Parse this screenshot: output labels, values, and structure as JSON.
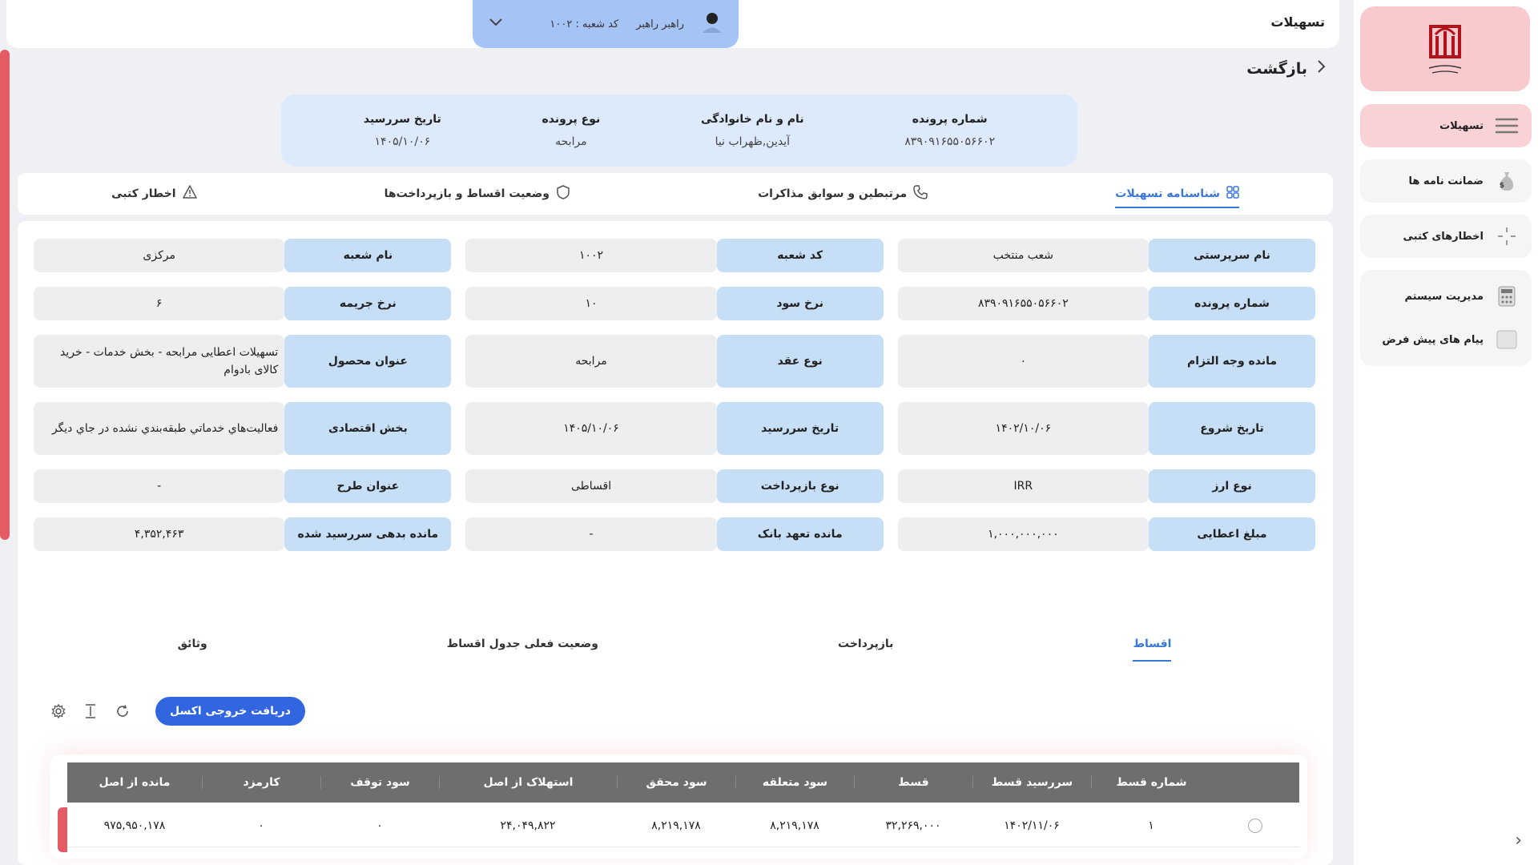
{
  "topbar": {
    "title": "تسهیلات",
    "user_name": "راهبر راهبر",
    "branch_code": "کد شعبه : ۱۰۰۲"
  },
  "sidebar": {
    "items": [
      {
        "label": "تسهیلات",
        "icon": "menu-icon",
        "active": true
      },
      {
        "label": "ضمانت نامه ها",
        "icon": "money-bag-icon"
      },
      {
        "label": "اخطارهای کتبی",
        "icon": "alert-icon"
      },
      {
        "label": "مدیریت سیستم",
        "icon": "calculator-icon"
      },
      {
        "label": "پیام های پیش فرض",
        "icon": "message-icon"
      }
    ]
  },
  "back_label": "بازگشت",
  "summary": [
    {
      "label": "شماره پرونده",
      "value": "۸۳۹۰۹۱۶۵۵۰۵۶۶۰۲"
    },
    {
      "label": "نام و نام خانوادگی",
      "value": "آیدین,ظهراب نیا"
    },
    {
      "label": "نوع پرونده",
      "value": "مرابحه"
    },
    {
      "label": "تاریخ سررسید",
      "value": "۱۴۰۵/۱۰/۰۶"
    }
  ],
  "tabs": [
    {
      "label": "شناسنامه تسهیلات",
      "active": true
    },
    {
      "label": "مرتبطین و سوابق مذاکرات"
    },
    {
      "label": "وضعیت اقساط و بازپرداخت‌ها"
    },
    {
      "label": "اخطار کتبی"
    }
  ],
  "details": {
    "r1": [
      {
        "k": "نام سرپرستی",
        "v": "شعب منتخب"
      },
      {
        "k": "کد شعبه",
        "v": "۱۰۰۲"
      },
      {
        "k": "نام شعبه",
        "v": "مرکزی"
      }
    ],
    "r2": [
      {
        "k": "شماره پرونده",
        "v": "۸۳۹۰۹۱۶۵۵۰۵۶۶۰۲"
      },
      {
        "k": "نرخ سود",
        "v": "۱۰"
      },
      {
        "k": "نرخ جریمه",
        "v": "۶"
      }
    ],
    "r3": [
      {
        "k": "مانده وجه التزام",
        "v": "۰"
      },
      {
        "k": "نوع عقد",
        "v": "مرابحه"
      },
      {
        "k": "عنوان محصول",
        "v": "تسهیلات اعطایی مرابحه - بخش خدمات - خرید کالای بادوام"
      }
    ],
    "r4": [
      {
        "k": "تاریخ شروع",
        "v": "۱۴۰۲/۱۰/۰۶"
      },
      {
        "k": "تاریخ سررسید",
        "v": "۱۴۰۵/۱۰/۰۶"
      },
      {
        "k": "بخش اقتصادی",
        "v": "فعاليت‌هاي خدماتي طبقه‌بندي نشده در جاي ديگر"
      }
    ],
    "r5": [
      {
        "k": "نوع ارز",
        "v": "IRR"
      },
      {
        "k": "نوع بازپرداخت",
        "v": "اقساطی"
      },
      {
        "k": "عنوان طرح",
        "v": "-"
      }
    ],
    "r6": [
      {
        "k": "مبلغ اعطایی",
        "v": "۱,۰۰۰,۰۰۰,۰۰۰"
      },
      {
        "k": "مانده تعهد بانک",
        "v": "-"
      },
      {
        "k": "مانده بدهی سررسید شده",
        "v": "۴,۳۵۲,۴۶۳"
      }
    ]
  },
  "subtabs": [
    {
      "label": "اقساط",
      "active": true
    },
    {
      "label": "بازپرداخت"
    },
    {
      "label": "وضعیت فعلی جدول اقساط"
    },
    {
      "label": "وثائق"
    }
  ],
  "toolbar": {
    "excel_label": "دریافت خروجی اکسل"
  },
  "table": {
    "headers": [
      "",
      "شماره قسط",
      "سررسید قسط",
      "قسط",
      "سود متعلقه",
      "سود محقق",
      "استهلاک از اصل",
      "سود توقف",
      "کارمزد",
      "مانده از اصل"
    ],
    "rows": [
      [
        "",
        "۱",
        "۱۴۰۲/۱۱/۰۶",
        "۳۲,۲۶۹,۰۰۰",
        "۸,۲۱۹,۱۷۸",
        "۸,۲۱۹,۱۷۸",
        "۲۴,۰۴۹,۸۲۲",
        "۰",
        "۰",
        "۹۷۵,۹۵۰,۱۷۸"
      ]
    ]
  },
  "colors": {
    "accent": "#3a78d8",
    "brand": "#e45b63",
    "key_bg": "#c6dff7"
  }
}
